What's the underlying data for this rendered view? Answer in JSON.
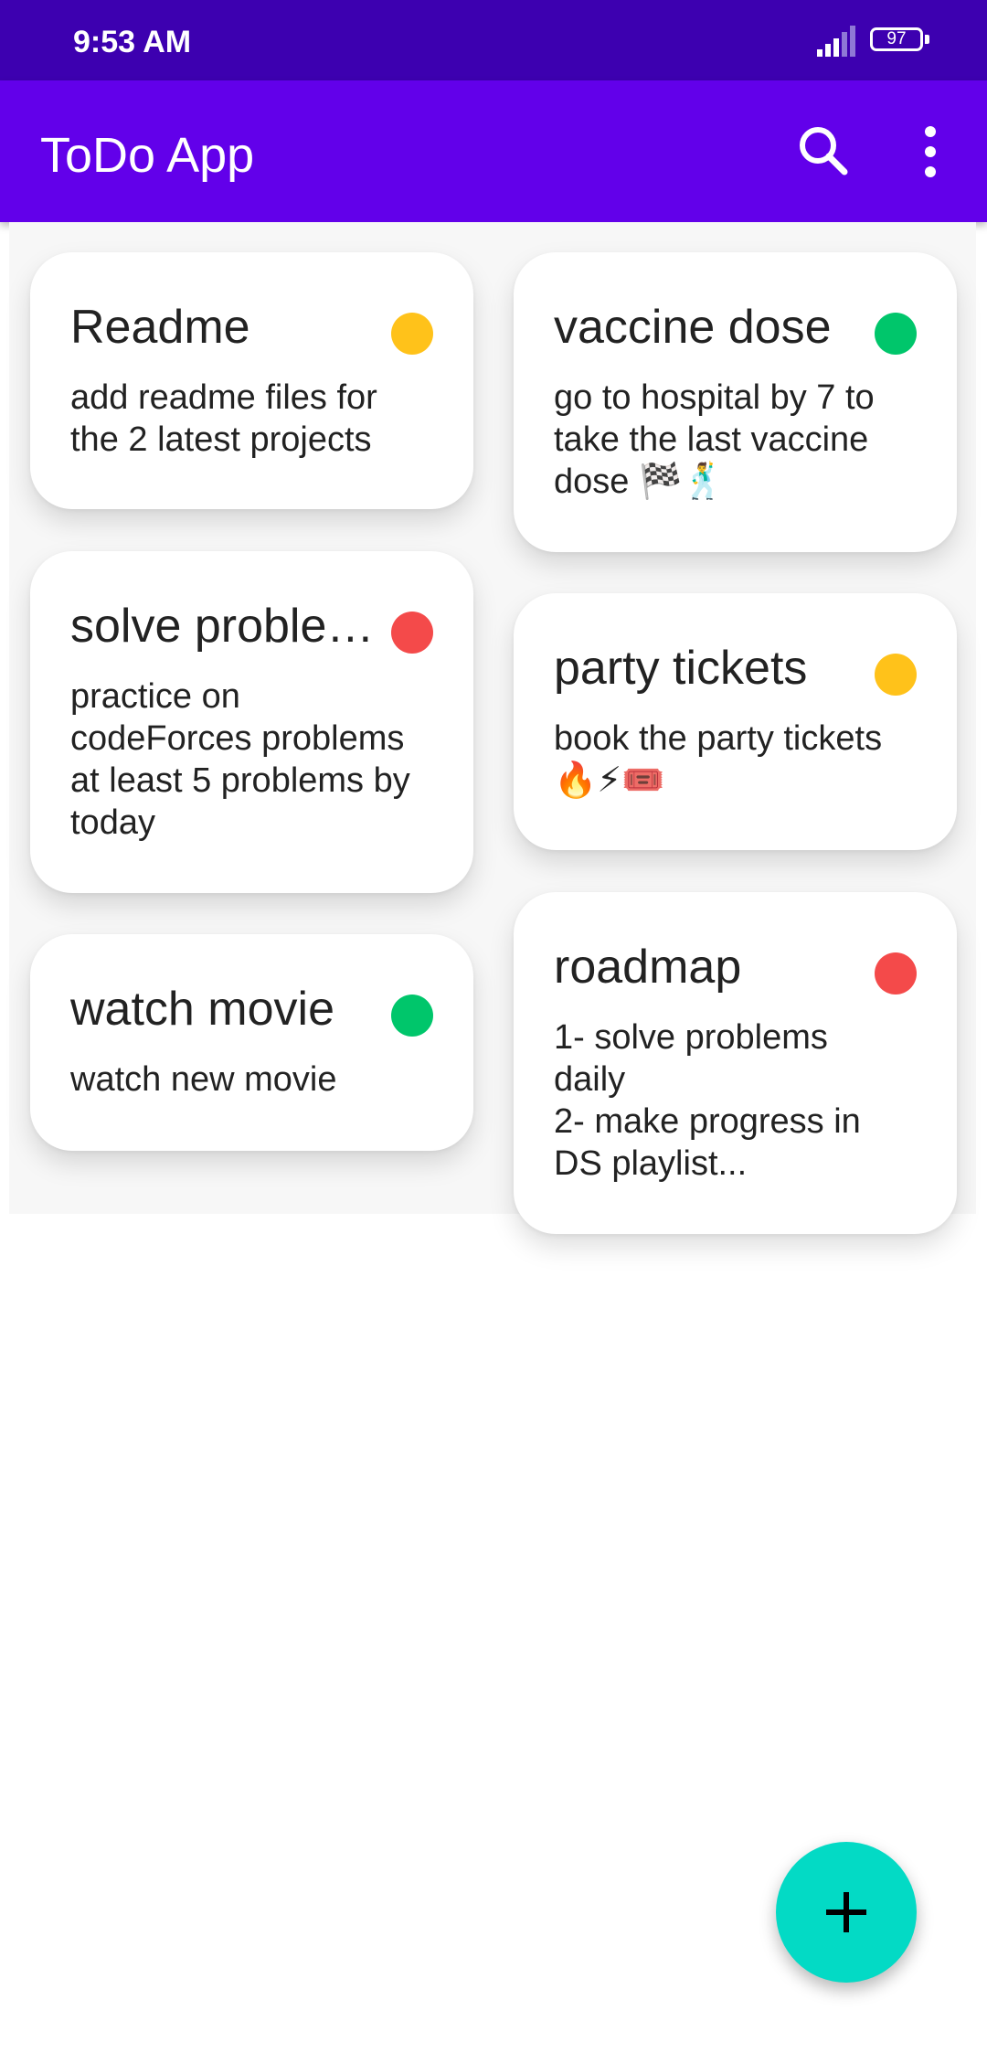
{
  "status_bar": {
    "time": "9:53 AM",
    "battery": "97",
    "signal_icon": "cell-signal-icon",
    "battery_icon": "battery-icon"
  },
  "app_bar": {
    "title": "ToDo App",
    "search_icon": "search-icon",
    "more_icon": "more-vert-icon"
  },
  "priority_colors": {
    "low": "#ffc21a",
    "medium": "#00c66b",
    "high": "#f44a4a"
  },
  "notes": [
    {
      "title": "Readme",
      "body": "add readme files for\nthe 2 latest projects",
      "priority_color": "#ffc21a"
    },
    {
      "title": "vaccine dose",
      "body": "go to hospital by 7 to\ntake the last vaccine\ndose 🏁🕺",
      "priority_color": "#00c66b"
    },
    {
      "title": "solve problems",
      "body": "practice on\ncodeForces problems\nat least 5 problems by\ntoday",
      "priority_color": "#f44a4a"
    },
    {
      "title": "party tickets",
      "body": "book the party tickets\n🔥⚡🎟️",
      "priority_color": "#ffc21a"
    },
    {
      "title": "watch movie",
      "body": "watch new movie",
      "priority_color": "#00c66b"
    },
    {
      "title": "roadmap",
      "body": "1- solve problems\ndaily\n2- make progress in\nDS playlist...",
      "priority_color": "#f44a4a"
    }
  ],
  "fab": {
    "icon": "add-icon",
    "color": "#03dac5"
  }
}
